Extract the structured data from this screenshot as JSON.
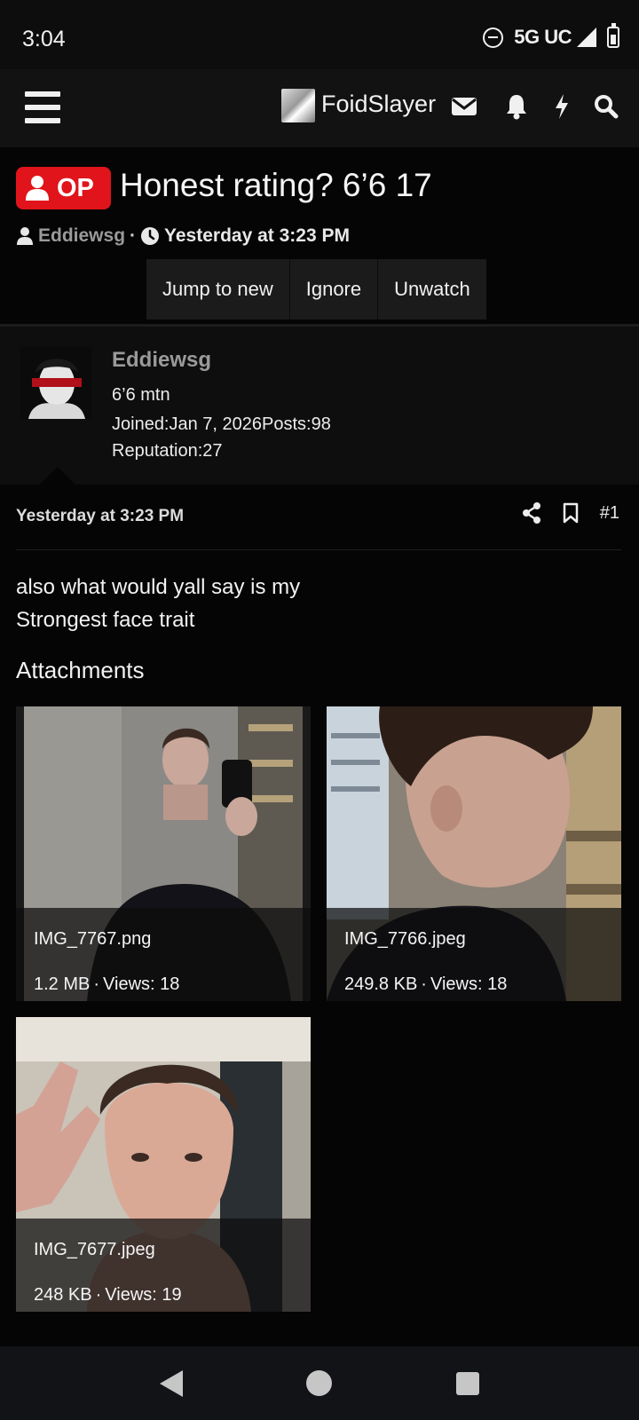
{
  "status_bar": {
    "time": "3:04",
    "network": "5G UC",
    "icons": [
      "do-not-disturb-icon",
      "signal-icon",
      "battery-icon"
    ]
  },
  "header": {
    "site_name": "FoidSlayer",
    "icons": [
      "menu-icon",
      "envelope-icon",
      "bell-icon",
      "bolt-icon",
      "search-icon"
    ]
  },
  "thread": {
    "badge": "OP",
    "title": "Honest rating? 6’6 17",
    "author": "Eddiewsg",
    "separator": "·",
    "date": "Yesterday at 3:23 PM",
    "actions": [
      "Jump to new",
      "Ignore",
      "Unwatch"
    ]
  },
  "user": {
    "name": "Eddiewsg",
    "title": "6’6 mtn",
    "joined_label": "Joined:",
    "joined": "Jan 7, 2026",
    "posts_label": "Posts:",
    "posts": "98",
    "reputation_label": "Reputation:",
    "reputation": "27"
  },
  "post": {
    "date": "Yesterday at 3:23 PM",
    "number": "#1",
    "body_line1": "also what would yall say is my",
    "body_line2": "Strongest face trait",
    "attachments_heading": "Attachments",
    "attachments": [
      {
        "name": "IMG_7767.png",
        "size": "1.2 MB",
        "sep": "·",
        "views": "Views: 18"
      },
      {
        "name": "IMG_7766.jpeg",
        "size": "249.8 KB",
        "sep": "·",
        "views": "Views: 18"
      },
      {
        "name": "IMG_7677.jpeg",
        "size": "248 KB",
        "sep": "·",
        "views": "Views: 19"
      }
    ]
  },
  "colors": {
    "badge": "#e0141a",
    "background": "#050505",
    "card": "#0e0e0e",
    "muted": "#9a9a9a"
  }
}
